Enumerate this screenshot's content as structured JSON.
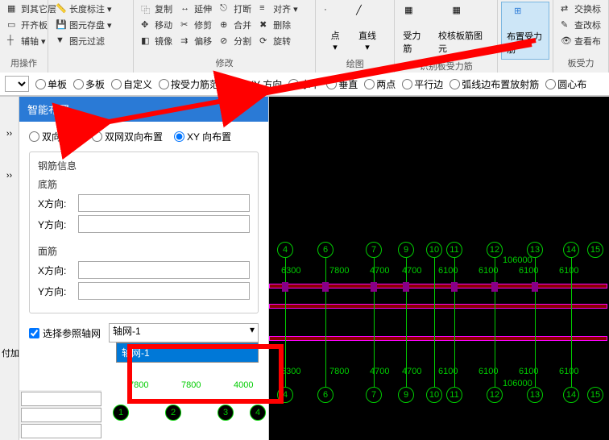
{
  "ribbon": {
    "left_truncated_top": "到其它层",
    "left_truncated_mid": "开齐板",
    "left_truncated_bot": "辅轴",
    "length_dim": "长度标注",
    "layer_save": "图元存盘",
    "layer_filter": "图元过滤",
    "group_use": "用操作",
    "copy": "复制",
    "move": "移动",
    "mirror": "镜像",
    "extend": "延伸",
    "trim": "修剪",
    "offset": "偏移",
    "break": "打断",
    "merge": "合并",
    "split": "分割",
    "align": "对齐",
    "delete": "删除",
    "rotate": "旋转",
    "group_modify": "修改",
    "point": "点",
    "line": "直线",
    "group_draw_trunc": "绘图",
    "smart_recognize": "布置受力筋",
    "group_recognize": "识别板受力筋",
    "smart_recognize_sub1": "受力筋",
    "smart_recognize_sub2": "校核板筋图元",
    "swap_label": "交换标",
    "view_edit": "查改标",
    "view_layout": "查看布",
    "group_slab": "板受力"
  },
  "radio_bar": {
    "r1": "单板",
    "r2": "多板",
    "r3": "自定义",
    "r4": "按受力筋范围",
    "r5": "XY 方向",
    "r6": "水平",
    "r7": "垂直",
    "r8": "两点",
    "r9": "平行边",
    "r10": "弧线边布置放射筋",
    "r11": "圆心布"
  },
  "side": {
    "use": "用操作",
    "add": "付加"
  },
  "panel": {
    "title": "智能布置",
    "radio_both": "双向布置",
    "radio_dual": "双网双向布置",
    "radio_xy": "XY 向布置",
    "rebar_info": "钢筋信息",
    "bottom_bar": "底筋",
    "top_bar": "面筋",
    "x_dir": "X方向:",
    "y_dir": "Y方向:",
    "ref_check": "选择参照轴网",
    "ref_value": "轴网-1",
    "ref_option": "轴网-1"
  },
  "chart_data": {
    "type": "table",
    "note": "CAD grid view with axis bubbles and dimension strings",
    "axis_bubbles_top_row": [
      4,
      6,
      7,
      9,
      10,
      11,
      12,
      13,
      14,
      15
    ],
    "axis_bubbles_bottom_row1": [
      4,
      6,
      7,
      9,
      10,
      11,
      12,
      13,
      14,
      15
    ],
    "axis_bubbles_bottom_row2": [
      1,
      2,
      3,
      4
    ],
    "dim_string_upper": [
      6300,
      7800,
      4700,
      4700,
      6100,
      6100,
      6100,
      6100
    ],
    "dim_total_upper": 106000,
    "dim_string_lower_left": [
      7800,
      7800,
      4000
    ],
    "dim_string_lower_right": [
      6300,
      7800,
      4700,
      4700,
      6100,
      6100,
      6100,
      6100
    ],
    "dim_total_lower": 106000
  }
}
